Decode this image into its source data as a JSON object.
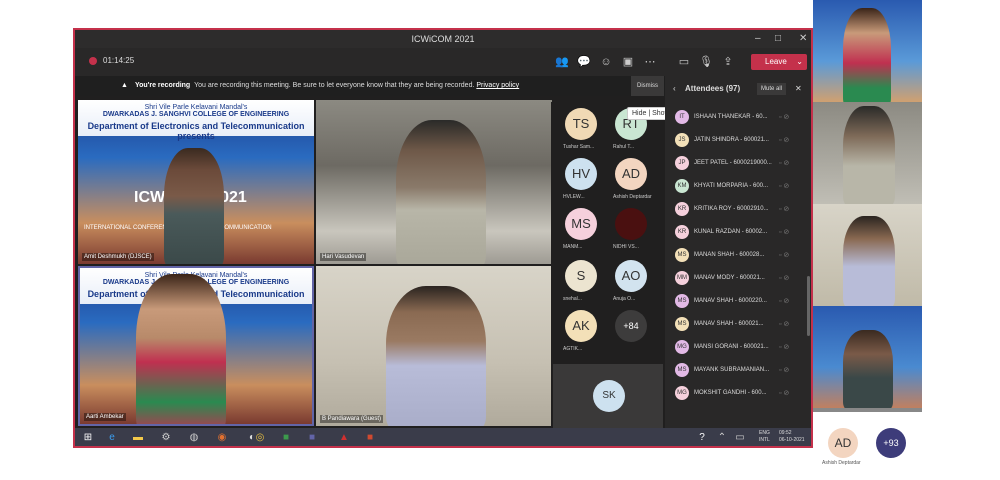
{
  "window": {
    "title": "ICWiCOM 2021"
  },
  "toolbar": {
    "timer": "01:14:25",
    "leave": "Leave"
  },
  "recording": {
    "bold": "You're recording",
    "text": "You are recording this meeting. Be sure to let everyone know that they are being recorded.",
    "link": "Privacy policy"
  },
  "tooltip": {
    "hide": "Hide",
    "show": "Show conversation"
  },
  "dismiss": "Dismiss",
  "slide": {
    "college1": "Shri Vile Parle Kelavani Mandal's",
    "college2": "DWARKADAS J. SANGHVI COLLEGE OF ENGINEERING",
    "dept": "Department of Electronics and Telecommunication presents",
    "big": "ICWiCOM 2021",
    "sub": "INTERNATIONAL CONFERENCE ON WIRELESS COMMUNICATION"
  },
  "tiles": [
    {
      "name": "Amit Deshmukh (DJSCE)"
    },
    {
      "name": "Hari Vasudevan"
    },
    {
      "name": "Aarti Ambekar"
    },
    {
      "name": "B Pandiawara (Guest)"
    }
  ],
  "grid": [
    {
      "i": "TS",
      "label": "Tushar Sam...",
      "c": "#f0d9b5"
    },
    {
      "i": "RT",
      "label": "Rahul T...",
      "c": "#c9e6d2"
    },
    {
      "i": "HV",
      "label": "HVLEW...",
      "c": "#cde1ef"
    },
    {
      "i": "AD",
      "label": "Ashish Deptardar",
      "c": "#f3d5c0"
    },
    {
      "i": "MS",
      "label": "MANM...",
      "c": "#f5d0dc"
    },
    {
      "i": "",
      "label": "NIDHI VS...",
      "c": "#4a1010"
    },
    {
      "i": "S",
      "label": "snehal...",
      "c": "#ece4d0"
    },
    {
      "i": "AO",
      "label": "Anuja O...",
      "c": "#d2e3ef"
    },
    {
      "i": "AK",
      "label": "AGTIK...",
      "c": "#f3e0b8"
    },
    {
      "i": "+84",
      "label": "",
      "c": "#3d3c3c"
    }
  ],
  "selfav": "SK",
  "attendees": {
    "title": "Attendees (97)",
    "mute": "Mute all",
    "list": [
      {
        "i": "IT",
        "name": "ISHAAN THANEKAR - 60...",
        "c": "#e2b9e6"
      },
      {
        "i": "JS",
        "name": "JATIN SHINDRA - 600021...",
        "c": "#f3e0b8"
      },
      {
        "i": "JP",
        "name": "JEET PATEL - 6000219000...",
        "c": "#f5d0dc"
      },
      {
        "i": "KM",
        "name": "KHYATI MORPARIA - 600...",
        "c": "#c9e6d2"
      },
      {
        "i": "KR",
        "name": "KRITIKA ROY - 60002910...",
        "c": "#f5d0dc"
      },
      {
        "i": "KR",
        "name": "KUNAL RAZDAN - 60002...",
        "c": "#f5d0dc"
      },
      {
        "i": "MS",
        "name": "MANAN SHAH - 600028...",
        "c": "#f3e0b8"
      },
      {
        "i": "MM",
        "name": "MANAV MODY - 600021...",
        "c": "#f5d0dc"
      },
      {
        "i": "MS",
        "name": "MANAV SHAH - 6000220...",
        "c": "#e2b9e6"
      },
      {
        "i": "MS",
        "name": "MANAV SHAH - 600021...",
        "c": "#f3e0b8"
      },
      {
        "i": "MG",
        "name": "MANSI GORANI - 600021...",
        "c": "#e2b9e6"
      },
      {
        "i": "MS",
        "name": "MAYANK SUBRAMANIAN...",
        "c": "#e2b9e6"
      },
      {
        "i": "MG",
        "name": "MOKSHIT GANDHI - 600...",
        "c": "#f5d0dc"
      }
    ]
  },
  "taskbar": {
    "lang": "ENG",
    "region": "INTL",
    "time": "09:52",
    "date": "06-10-2021"
  },
  "bottom": {
    "i": "AD",
    "label": "Ashish Deptardar",
    "more": "+93"
  }
}
